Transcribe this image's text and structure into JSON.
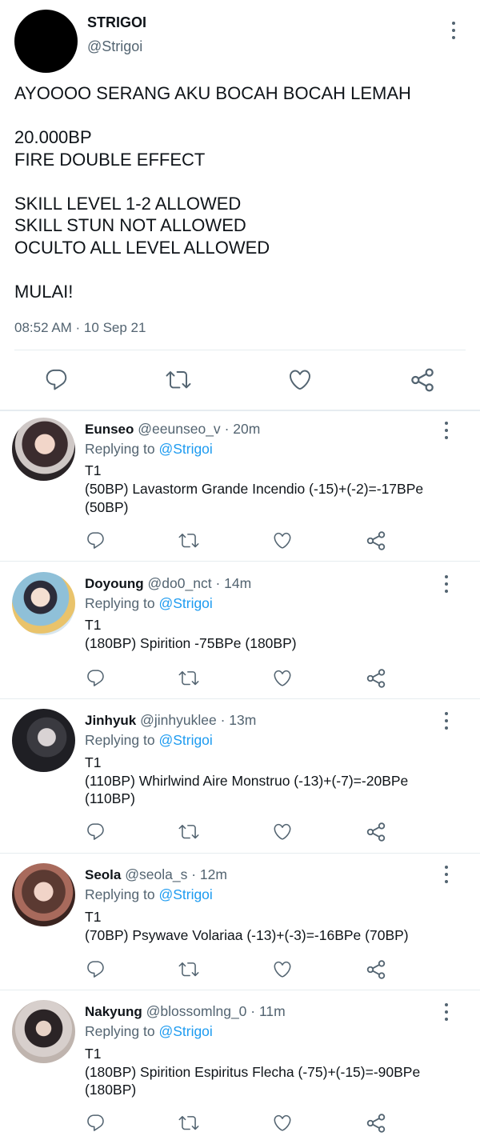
{
  "tweet": {
    "display_name": "STRIGOI",
    "handle": "@Strigoi",
    "lines": [
      "AYOOOO SERANG AKU BOCAH BOCAH LEMAH",
      "",
      "20.000BP",
      "FIRE DOUBLE EFFECT",
      "",
      "SKILL LEVEL 1-2 ALLOWED",
      "SKILL STUN NOT ALLOWED",
      "OCULTO ALL LEVEL ALLOWED",
      "",
      "MULAI!"
    ],
    "timestamp": "08:52 AM · 10 Sep 21"
  },
  "replies": [
    {
      "name": "Eunseo",
      "handle": "@eeunseo_v",
      "time": "· 20m",
      "replying_prefix": "Replying to",
      "replying_to": "@Strigoi",
      "lines": [
        "T1",
        "(50BP) Lavastorm Grande Incendio (-15)+(-2)=-17BPe",
        "(50BP)"
      ]
    },
    {
      "name": "Doyoung",
      "handle": "@do0_nct",
      "time": "· 14m",
      "replying_prefix": "Replying to",
      "replying_to": "@Strigoi",
      "lines": [
        "T1",
        "(180BP) Spirition -75BPe (180BP)"
      ]
    },
    {
      "name": "Jinhyuk",
      "handle": "@jinhyuklee",
      "time": "· 13m",
      "replying_prefix": "Replying to",
      "replying_to": "@Strigoi",
      "lines": [
        "T1",
        "(110BP) Whirlwind Aire Monstruo (-13)+(-7)=-20BPe",
        "(110BP)"
      ]
    },
    {
      "name": "Seola",
      "handle": "@seola_s",
      "time": "· 12m",
      "replying_prefix": "Replying to",
      "replying_to": "@Strigoi",
      "lines": [
        "T1",
        "(70BP) Psywave Volariaa (-13)+(-3)=-16BPe (70BP)"
      ]
    },
    {
      "name": "Nakyung",
      "handle": "@blossomlng_0",
      "time": "· 11m",
      "replying_prefix": "Replying to",
      "replying_to": "@Strigoi",
      "lines": [
        "T1",
        "(180BP) Spirition Espiritus Flecha (-75)+(-15)=-90BPe",
        "(180BP)"
      ]
    }
  ],
  "icons": {
    "reply": "reply-icon",
    "retweet": "retweet-icon",
    "like": "heart-icon",
    "share": "share-icon",
    "more": "more-options-icon"
  },
  "colors": {
    "link": "#1d9bf0",
    "muted": "#536471",
    "text": "#0f1419",
    "divider": "#e6ecf0"
  }
}
